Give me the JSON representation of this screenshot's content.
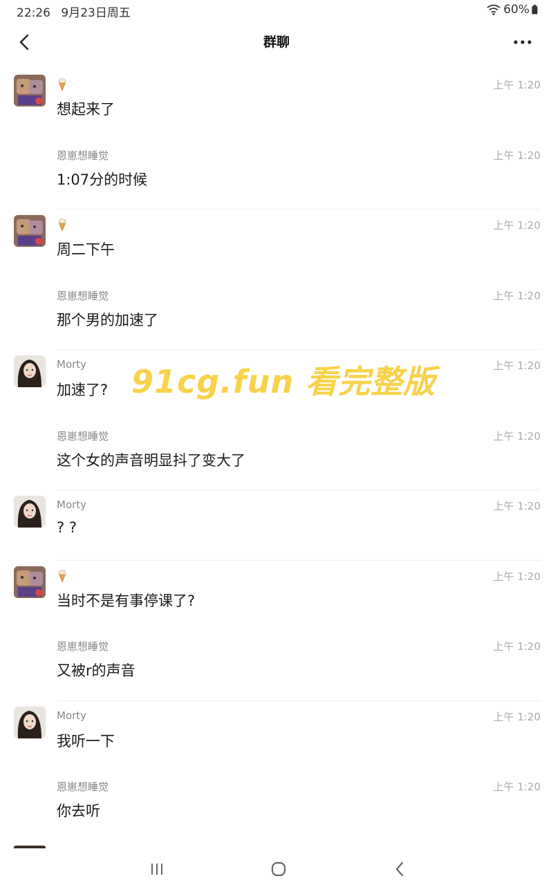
{
  "status_bar": {
    "time": "22:26",
    "date": "9月23日周五",
    "battery": "60%"
  },
  "header": {
    "title": "群聊"
  },
  "messages": [
    {
      "sender": "",
      "sender_icon": "ice-cream-icon",
      "text": "想起来了",
      "time": "上午 1:20",
      "avatar": "avatar-a",
      "show_avatar": true
    },
    {
      "sender": "恩崽想睡觉",
      "text": "1:07分的时候",
      "time": "上午 1:20",
      "show_avatar": false
    },
    {
      "sender": "",
      "sender_icon": "ice-cream-icon",
      "text": "周二下午",
      "time": "上午 1:20",
      "avatar": "avatar-a",
      "show_avatar": true
    },
    {
      "sender": "恩崽想睡觉",
      "text": "那个男的加速了",
      "time": "上午 1:20",
      "show_avatar": false
    },
    {
      "sender": "Morty",
      "text": "加速了?",
      "time": "上午 1:20",
      "avatar": "avatar-b",
      "show_avatar": true
    },
    {
      "sender": "恩崽想睡觉",
      "text": "这个女的声音明显抖了变大了",
      "time": "上午 1:20",
      "show_avatar": false
    },
    {
      "sender": "Morty",
      "text": "? ?",
      "time": "上午 1:20",
      "avatar": "avatar-b",
      "show_avatar": true
    },
    {
      "sender": "",
      "sender_icon": "ice-cream-icon",
      "text": "当时不是有事停课了?",
      "time": "上午 1:20",
      "avatar": "avatar-a",
      "show_avatar": true
    },
    {
      "sender": "恩崽想睡觉",
      "text": "又被r的声音",
      "time": "上午 1:20",
      "show_avatar": false
    },
    {
      "sender": "Morty",
      "text": "我听一下",
      "time": "上午 1:20",
      "avatar": "avatar-b",
      "show_avatar": true
    },
    {
      "sender": "恩崽想睡觉",
      "text": "你去听",
      "time": "上午 1:20",
      "show_avatar": false
    }
  ],
  "watermark": "91cg.fun 看完整版",
  "icons": {
    "back": "chevron-left-icon",
    "more": "more-dots-icon",
    "wifi": "wifi-icon",
    "battery": "battery-icon",
    "nav_recent": "recent-apps-icon",
    "nav_home": "home-icon",
    "nav_back": "back-icon"
  }
}
